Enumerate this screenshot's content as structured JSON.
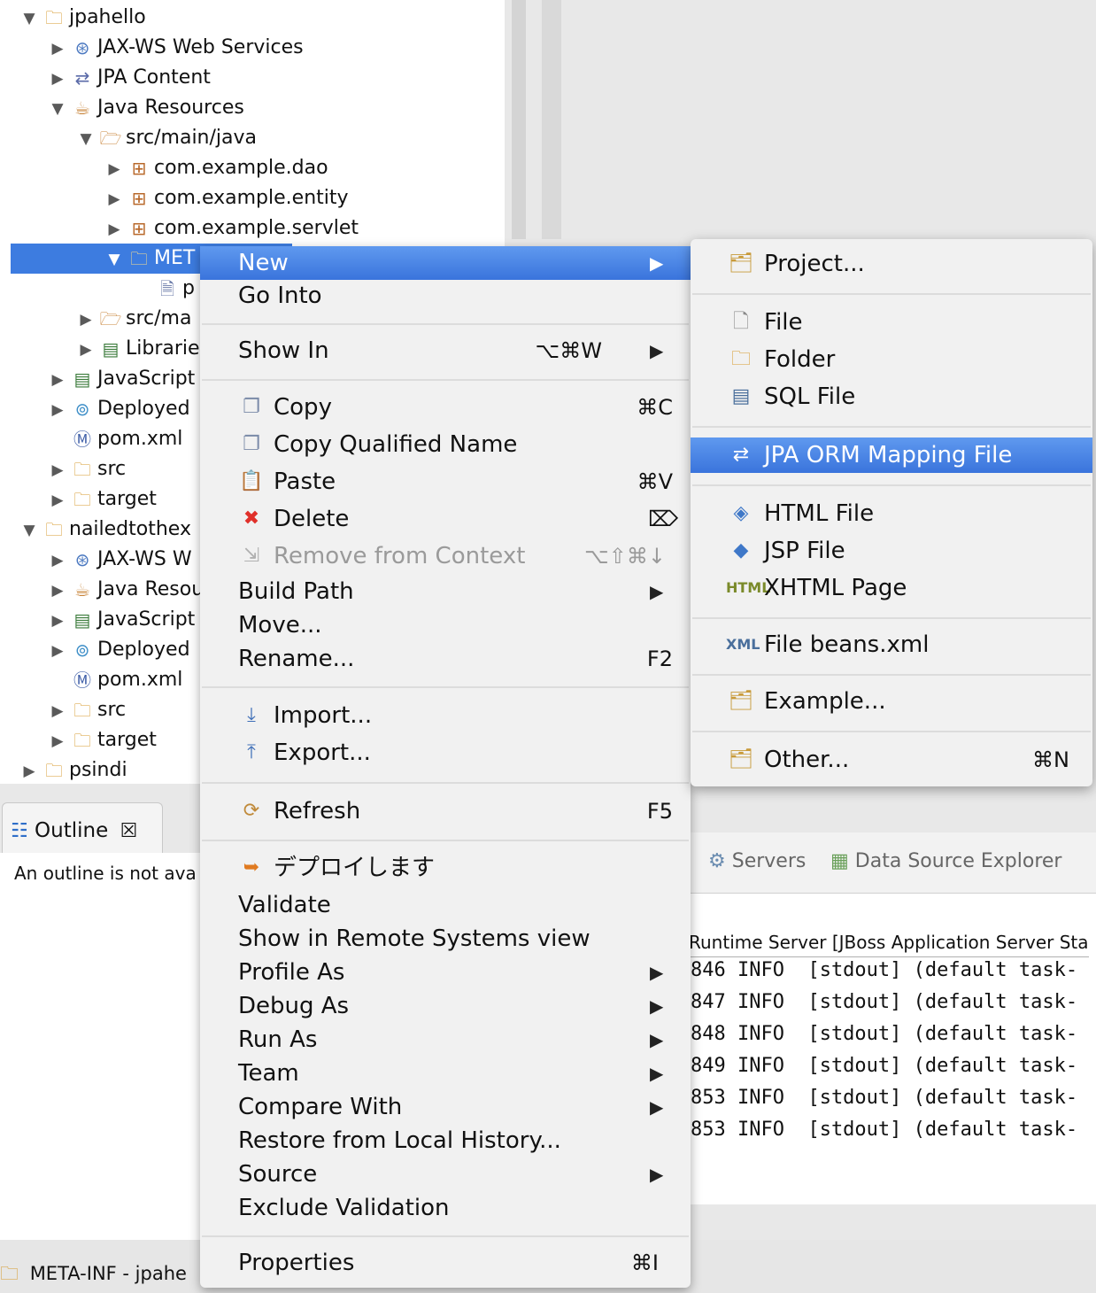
{
  "explorer": {
    "rows": [
      {
        "label": "jpahello",
        "icon": "folder-icon",
        "arrow": "▼",
        "expanded": true
      },
      {
        "label": "JAX-WS Web Services",
        "icon": "web-services-icon",
        "arrow": "▶"
      },
      {
        "label": "JPA Content",
        "icon": "jpa-icon",
        "arrow": "▶"
      },
      {
        "label": "Java Resources",
        "icon": "java-resources-icon",
        "arrow": "▼"
      },
      {
        "label": "src/main/java",
        "icon": "source-folder-icon",
        "arrow": "▼"
      },
      {
        "label": "com.example.dao",
        "icon": "package-icon",
        "arrow": "▶"
      },
      {
        "label": "com.example.entity",
        "icon": "package-icon",
        "arrow": "▶"
      },
      {
        "label": "com.example.servlet",
        "icon": "package-icon",
        "arrow": "▶"
      },
      {
        "label": "MET",
        "icon": "folder-icon",
        "arrow": "▼",
        "selected": true
      },
      {
        "label": "p",
        "icon": "file-icon",
        "arrow": ""
      },
      {
        "label": "src/ma",
        "icon": "source-folder-icon",
        "arrow": "▶"
      },
      {
        "label": "Librarie",
        "icon": "library-icon",
        "arrow": "▶"
      },
      {
        "label": "JavaScript",
        "icon": "library-icon",
        "arrow": "▶"
      },
      {
        "label": "Deployed",
        "icon": "deployed-icon",
        "arrow": "▶"
      },
      {
        "label": "pom.xml",
        "icon": "maven-file-icon",
        "arrow": ""
      },
      {
        "label": "src",
        "icon": "folder-icon",
        "arrow": "▶"
      },
      {
        "label": "target",
        "icon": "folder-icon",
        "arrow": "▶"
      },
      {
        "label": "nailedtothex",
        "icon": "folder-icon",
        "arrow": "▼"
      },
      {
        "label": "JAX-WS W",
        "icon": "web-services-icon",
        "arrow": "▶"
      },
      {
        "label": "Java Resou",
        "icon": "java-resources-icon",
        "arrow": "▶"
      },
      {
        "label": "JavaScript",
        "icon": "library-icon",
        "arrow": "▶"
      },
      {
        "label": "Deployed",
        "icon": "deployed-icon",
        "arrow": "▶"
      },
      {
        "label": "pom.xml",
        "icon": "maven-file-icon",
        "arrow": ""
      },
      {
        "label": "src",
        "icon": "folder-icon",
        "arrow": "▶"
      },
      {
        "label": "target",
        "icon": "folder-icon",
        "arrow": "▶"
      },
      {
        "label": "psindi",
        "icon": "folder-icon",
        "arrow": "▶"
      }
    ]
  },
  "outline": {
    "title": "Outline",
    "close": "☒",
    "message": "An outline is not ava"
  },
  "status_bar": {
    "text": "META-INF - jpahe"
  },
  "console": {
    "tabs": [
      "Servers",
      "Data Source Explorer"
    ],
    "header": "Runtime Server [JBoss Application Server Sta",
    "lines": [
      "846 INFO  [stdout] (default task-",
      "847 INFO  [stdout] (default task-",
      "848 INFO  [stdout] (default task-",
      "849 INFO  [stdout] (default task-",
      "853 INFO  [stdout] (default task-",
      "853 INFO  [stdout] (default task-"
    ]
  },
  "context_menu": {
    "new": "New",
    "go_into": "Go Into",
    "show_in": "Show In",
    "show_in_sc": "⌥⌘W",
    "copy": "Copy",
    "copy_sc": "⌘C",
    "copy_qualified": "Copy Qualified Name",
    "paste": "Paste",
    "paste_sc": "⌘V",
    "delete": "Delete",
    "delete_sc": "⌦",
    "remove_context": "Remove from Context",
    "remove_context_sc": "⌥⇧⌘↓",
    "build_path": "Build Path",
    "move": "Move...",
    "rename": "Rename...",
    "rename_sc": "F2",
    "import": "Import...",
    "export": "Export...",
    "refresh": "Refresh",
    "refresh_sc": "F5",
    "deploy": "デプロイします",
    "validate": "Validate",
    "show_remote": "Show in Remote Systems view",
    "profile_as": "Profile As",
    "debug_as": "Debug As",
    "run_as": "Run As",
    "team": "Team",
    "compare_with": "Compare With",
    "restore_history": "Restore from Local History...",
    "source": "Source",
    "exclude_validation": "Exclude Validation",
    "properties": "Properties",
    "properties_sc": "⌘I",
    "arrow": "▶"
  },
  "submenu": {
    "project": "Project...",
    "file": "File",
    "folder": "Folder",
    "sql_file": "SQL File",
    "jpa_orm": "JPA ORM Mapping File",
    "html_file": "HTML File",
    "jsp_file": "JSP File",
    "xhtml_page": "XHTML Page",
    "beans_xml": "File beans.xml",
    "example": "Example...",
    "other": "Other...",
    "other_sc": "⌘N"
  },
  "colors": {
    "highlight": "#3a74dc",
    "selection": "#3d7ce0",
    "delete_icon": "#e0302a"
  }
}
